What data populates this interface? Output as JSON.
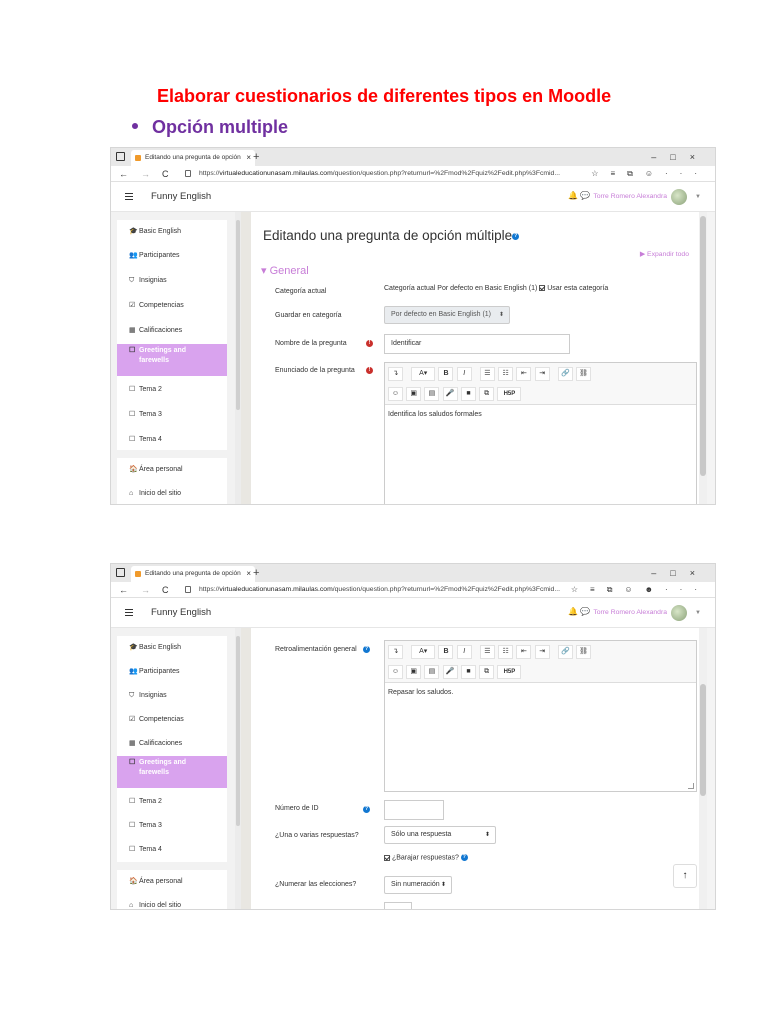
{
  "doc": {
    "title": "Elaborar cuestionarios de diferentes tipos en Moodle",
    "bullet": "Opción multiple"
  },
  "browser": {
    "tab_title": "Editando una pregunta de opción",
    "tab_close": "×",
    "new_tab": "+",
    "window_controls": "–□×",
    "back": "←",
    "forward": "→",
    "reload": "C",
    "url_prefix": "https://",
    "url_host": "virtualeducationunasam.milaulas.com",
    "url_path": "/question/question.php?returnurl=%2Fmod%2Fquiz%2Fedit.php%3Fcmid...",
    "url_path_2": "/question/question.php?returnurl=%2Fmod%2Fquiz%2Fedit.php%3Fcmid..."
  },
  "header": {
    "site_name": "Funny English",
    "user_name": "Torre Romero Alexandra"
  },
  "nav": {
    "items": [
      {
        "icon": "🎓",
        "label": "Basic English"
      },
      {
        "icon": "👥",
        "label": "Participantes"
      },
      {
        "icon": "⛉",
        "label": "Insignias"
      },
      {
        "icon": "☑",
        "label": "Competencias"
      },
      {
        "icon": "▦",
        "label": "Calificaciones"
      },
      {
        "icon": "☐",
        "label": "Greetings and",
        "label2": "farewells"
      },
      {
        "icon": "☐",
        "label": "Tema 2"
      },
      {
        "icon": "☐",
        "label": "Tema 3"
      },
      {
        "icon": "☐",
        "label": "Tema 4"
      },
      {
        "icon": "🏠",
        "label": "Área personal"
      },
      {
        "icon": "⌂",
        "label": "Inicio del sitio"
      }
    ]
  },
  "form1": {
    "heading": "Editando una pregunta de opción múltiple",
    "expand_all": "Expandir todo",
    "section": "General",
    "category_label": "Categoría actual",
    "category_value": "Categoría actual  Por defecto en Basic English (1)",
    "use_category": "Usar esta categoría",
    "save_in_label": "Guardar en categoría",
    "save_in_value": "Por defecto en Basic English (1)",
    "name_label": "Nombre de la pregunta",
    "name_value": "Identificar",
    "statement_label": "Enunciado de la pregunta",
    "statement_value": "Identifica los saludos formales"
  },
  "form2": {
    "feedback_label": "Retroalimentación general",
    "feedback_value": "Repasar los saludos.",
    "id_label": "Número de ID",
    "answers_label": "¿Una o varias respuestas?",
    "answers_value": "Sólo una respuesta",
    "shuffle_label": "¿Barajar respuestas?",
    "numbering_label": "¿Numerar las elecciones?",
    "numbering_value": "Sin numeración"
  },
  "toolbar": {
    "row1": [
      "↴",
      "A▾",
      "B",
      "I",
      "☰",
      "☷",
      "⇤",
      "⇥",
      "🔗",
      "⛓"
    ],
    "row2": [
      "☺",
      "▣",
      "▤",
      "🎤",
      "■",
      "⧉",
      "H5P"
    ]
  },
  "colors": {
    "title_red": "#ff0000",
    "bullet_purple": "#7030a0",
    "accent_lilac": "#d9a3ee",
    "link_lilac": "#c77dd7",
    "required_red": "#c9302c",
    "help_blue": "#1177d1"
  }
}
